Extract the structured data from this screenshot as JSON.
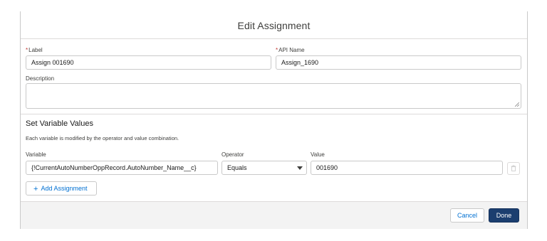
{
  "modal": {
    "title": "Edit Assignment"
  },
  "form": {
    "label": {
      "required_mark": "*",
      "label": "Label",
      "value": "Assign 001690"
    },
    "api_name": {
      "required_mark": "*",
      "label": "API Name",
      "value": "Assign_1690"
    },
    "description": {
      "label": "Description",
      "value": ""
    }
  },
  "section": {
    "title": "Set Variable Values",
    "help_text": "Each variable is modified by the operator and value combination.",
    "columns": {
      "variable": "Variable",
      "operator": "Operator",
      "value": "Value"
    },
    "row": {
      "variable": "{!CurrentAutoNumberOppRecord.AutoNumber_Name__c}",
      "operator": "Equals",
      "value": "001690"
    },
    "add_button": {
      "icon": "+",
      "label": "Add Assignment"
    }
  },
  "footer": {
    "cancel_label": "Cancel",
    "done_label": "Done"
  },
  "colors": {
    "brand_button": "#1b3e6f",
    "link": "#0070d2",
    "required": "#c23934"
  },
  "icons": {
    "delete": "trash-icon",
    "select": "chevron-down-icon",
    "add": "plus-icon",
    "resize": "resize-handle-icon"
  }
}
